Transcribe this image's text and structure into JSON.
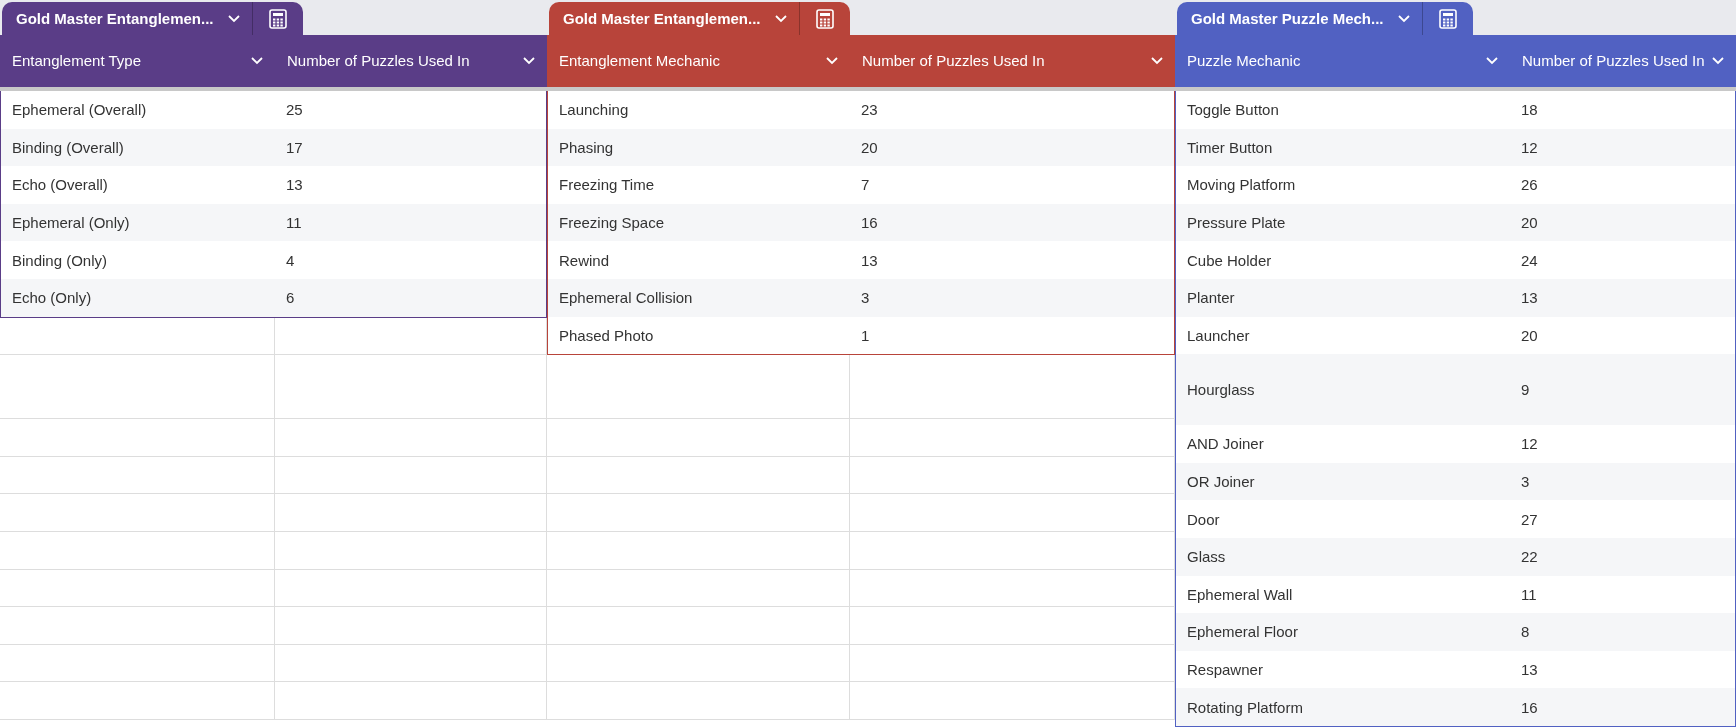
{
  "tables": [
    {
      "tab_title": "Gold Master Entanglemen...",
      "color": "#5a3d87",
      "columns": [
        "Entanglement Type",
        "Number of Puzzles Used In"
      ],
      "rows": [
        [
          "Ephemeral (Overall)",
          "25"
        ],
        [
          "Binding (Overall)",
          "17"
        ],
        [
          "Echo (Overall)",
          "13"
        ],
        [
          "Ephemeral (Only)",
          "11"
        ],
        [
          "Binding (Only)",
          "4"
        ],
        [
          "Echo (Only)",
          "6"
        ]
      ]
    },
    {
      "tab_title": "Gold Master Entanglemen...",
      "color": "#b8443a",
      "columns": [
        "Entanglement Mechanic",
        "Number of Puzzles Used In"
      ],
      "rows": [
        [
          "Launching",
          "23"
        ],
        [
          "Phasing",
          "20"
        ],
        [
          "Freezing Time",
          "7"
        ],
        [
          "Freezing Space",
          "16"
        ],
        [
          "Rewind",
          "13"
        ],
        [
          "Ephemeral Collision",
          "3"
        ],
        [
          "Phased Photo",
          "1"
        ]
      ]
    },
    {
      "tab_title": "Gold Master Puzzle Mech...",
      "color": "#5161c2",
      "columns": [
        "Puzzle Mechanic",
        "Number of Puzzles Used In"
      ],
      "rows": [
        [
          "Toggle Button",
          "18"
        ],
        [
          "Timer Button",
          "12"
        ],
        [
          "Moving Platform",
          "26"
        ],
        [
          "Pressure Plate",
          "20"
        ],
        [
          "Cube Holder",
          "24"
        ],
        [
          "Planter",
          "13"
        ],
        [
          "Launcher",
          "20"
        ],
        [
          "Hourglass",
          "9"
        ],
        [
          "AND Joiner",
          "12"
        ],
        [
          "OR Joiner",
          "3"
        ],
        [
          "Door",
          "27"
        ],
        [
          "Glass",
          "22"
        ],
        [
          "Ephemeral Wall",
          "11"
        ],
        [
          "Ephemeral Floor",
          "8"
        ],
        [
          "Respawner",
          "13"
        ],
        [
          "Rotating Platform",
          "16"
        ]
      ]
    }
  ]
}
